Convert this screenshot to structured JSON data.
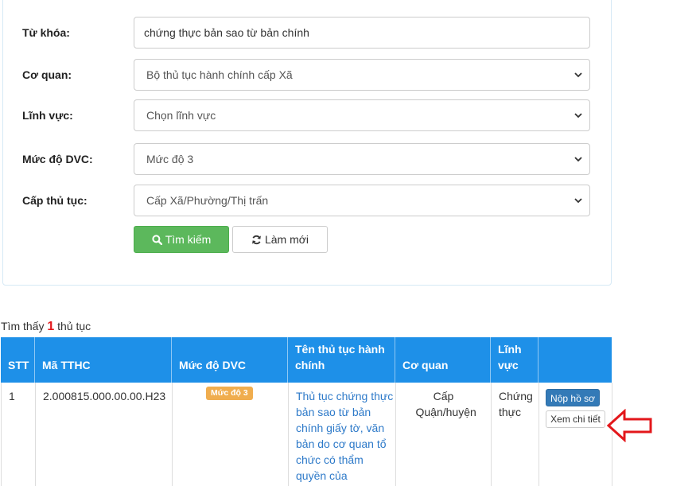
{
  "search_form": {
    "keyword": {
      "label": "Từ khóa:",
      "value": "chứng thực bản sao từ bản chính"
    },
    "agency": {
      "label": "Cơ quan:",
      "value": "Bộ thủ tục hành chính cấp Xã"
    },
    "field": {
      "label": "Lĩnh vực:",
      "value": "Chọn lĩnh vực"
    },
    "service_level": {
      "label": "Mức độ DVC:",
      "value": "Mức độ 3"
    },
    "procedure_level": {
      "label": "Cấp thủ tục:",
      "value": "Cấp Xã/Phường/Thị trấn"
    },
    "search_button": "Tìm kiếm",
    "reset_button": "Làm mới"
  },
  "results": {
    "prefix": "Tìm thấy",
    "count": "1",
    "suffix": "thủ tục"
  },
  "table": {
    "headers": [
      "STT",
      "Mã TTHC",
      "Mức độ DVC",
      "Tên thủ tục hành chính",
      "Cơ quan",
      "Lĩnh vực",
      ""
    ],
    "rows": [
      {
        "stt": "1",
        "code": "2.000815.000.00.00.H23",
        "level": "Mức độ 3",
        "name": "Thủ tục chứng thực bản sao từ bản chính giấy tờ, văn bản do cơ quan tổ chức có thẩm quyền của",
        "agency": "Cấp Quận/huyện",
        "field": "Chứng thực",
        "submit_label": "Nộp hồ sơ",
        "detail_label": "Xem chi tiết"
      }
    ]
  },
  "colors": {
    "header_bg": "#1e90e8",
    "search_button": "#5cb85c",
    "submit_button": "#337ab7",
    "badge": "#f0ad4e",
    "arrow": "#e3171b",
    "count": "#e3171b"
  }
}
